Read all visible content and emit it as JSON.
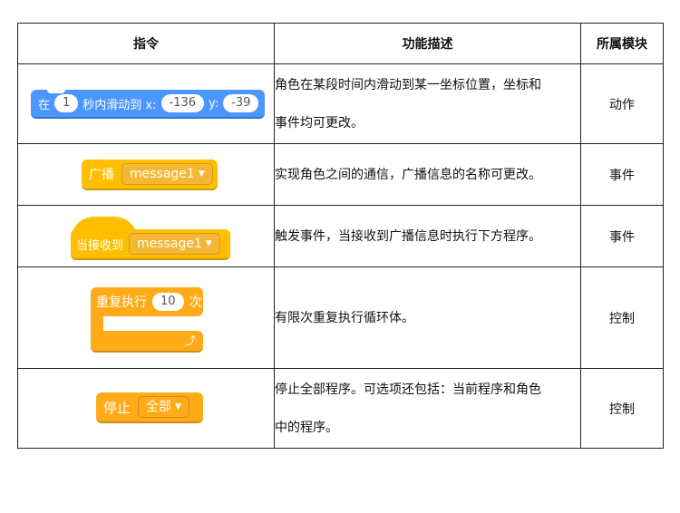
{
  "headers": {
    "command": "指令",
    "description": "功能描述",
    "module": "所属模块"
  },
  "rows": [
    {
      "block": {
        "prefix": "在",
        "secs": "1",
        "mid": "秒内滑动到 x:",
        "x": "-136",
        "ylabel": "y:",
        "y": "-39"
      },
      "description_lines": [
        "角色在某段时间内滑动到某一坐标位置，坐标和",
        "事件均可更改。"
      ],
      "module": "动作"
    },
    {
      "block": {
        "label": "广播",
        "option": "message1"
      },
      "description_lines": [
        "实现角色之间的通信，广播信息的名称可更改。"
      ],
      "module": "事件"
    },
    {
      "block": {
        "label": "当接收到",
        "option": "message1"
      },
      "description_lines": [
        "触发事件，当接收到广播信息时执行下方程序。"
      ],
      "module": "事件"
    },
    {
      "block": {
        "label": "重复执行",
        "count": "10",
        "suffix": "次"
      },
      "description_lines": [
        "有限次重复执行循环体。"
      ],
      "module": "控制"
    },
    {
      "block": {
        "label": "停止",
        "option": "全部"
      },
      "description_lines": [
        "停止全部程序。可选项还包括：当前程序和角色",
        "中的程序。"
      ],
      "module": "控制"
    }
  ],
  "colors": {
    "motion": "#4c97ff",
    "events": "#ffbf00",
    "control": "#ffab19"
  },
  "icons": {
    "dropdown": "caret-down-icon",
    "loop": "loop-arrow-icon"
  }
}
